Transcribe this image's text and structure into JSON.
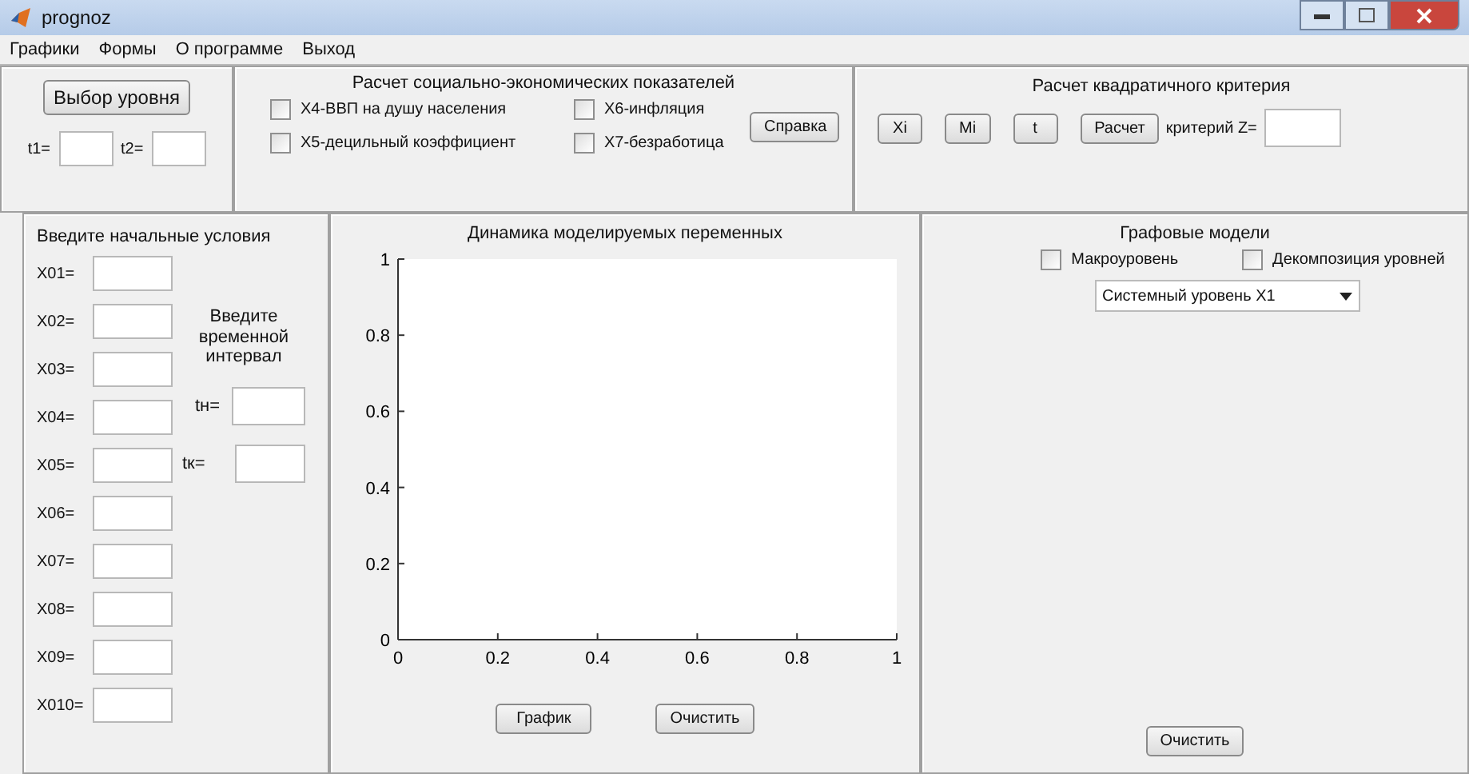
{
  "window": {
    "title": "prognoz"
  },
  "menu": [
    "Графики",
    "Формы",
    "О программе",
    "Выход"
  ],
  "level_panel": {
    "button": "Выбор уровня",
    "fields": [
      "t1=",
      "t2="
    ]
  },
  "indicators_panel": {
    "title": "Расчет социально-экономических показателей",
    "checkboxes": [
      {
        "label": "X4-ВВП на душу населения",
        "checked": false
      },
      {
        "label": "X6-инфляция",
        "checked": false
      },
      {
        "label": "X5-децильный коэффициент",
        "checked": false
      },
      {
        "label": "X7-безработица",
        "checked": false
      }
    ],
    "help_button": "Справка"
  },
  "criterion_panel": {
    "title": "Расчет квадратичного критерия",
    "buttons": [
      "Xi",
      "Mi",
      "t",
      "Расчет"
    ],
    "field_label": "критерий Z="
  },
  "initial_panel": {
    "title": "Введите начальные условия",
    "fields": [
      "X01=",
      "X02=",
      "X03=",
      "X04=",
      "X05=",
      "X06=",
      "X07=",
      "X08=",
      "X09=",
      "X010="
    ],
    "interval_title": "Введите временной интервал",
    "interval_fields": [
      "tн=",
      "tк="
    ]
  },
  "chart_panel": {
    "chart_data": {
      "type": "line",
      "title": "Динамика моделируемых переменных",
      "xlim": [
        0,
        1
      ],
      "ylim": [
        0,
        1
      ],
      "xticks": [
        0,
        0.2,
        0.4,
        0.6,
        0.8,
        1
      ],
      "yticks": [
        0,
        0.2,
        0.4,
        0.6,
        0.8,
        1
      ]
    },
    "buttons": [
      "График",
      "Очистить"
    ]
  },
  "graph_panel": {
    "title": "Графовые модели",
    "checkboxes": [
      {
        "label": "Макроуровень",
        "checked": false
      },
      {
        "label": "Декомпозиция уровней",
        "checked": false
      }
    ],
    "dropdown": {
      "value": "Системный уровень X1"
    },
    "button": "Очистить"
  }
}
